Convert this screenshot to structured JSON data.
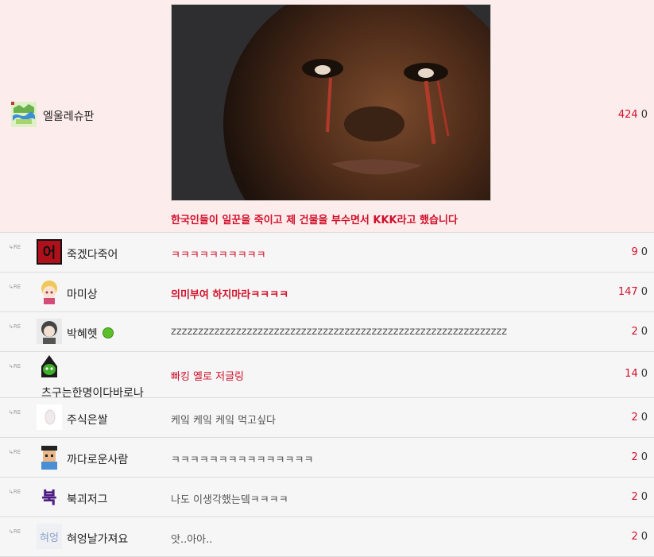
{
  "posts": [
    {
      "re": "",
      "nick": "엘울레슈판",
      "content": "한국인들이 일꾼을 죽이고 제 건물을 부수면서 KKK라고 했습니다",
      "hits": "424",
      "recs": "0"
    },
    {
      "re": "RE",
      "nick": "죽겠다죽어",
      "content": "ㅋㅋㅋㅋㅋㅋㅋㅋㅋㅋ",
      "hits": "9",
      "recs": "0"
    },
    {
      "re": "RE",
      "nick": "마미상",
      "content": "의미부여 하지마라ㅋㅋㅋㅋ",
      "hits": "147",
      "recs": "0"
    },
    {
      "re": "RE",
      "nick": "박혜헷",
      "content": "zzzzzzzzzzzzzzzzzzzzzzzzzzzzzzzzzzzzzzzzzzzzzzzzzzzzzzzzzzzzzz",
      "hits": "2",
      "recs": "0"
    },
    {
      "re": "RE",
      "nick": "츠구는한명이다바로나",
      "content": "빠킹 옐로 저글링",
      "hits": "14",
      "recs": "0"
    },
    {
      "re": "RE",
      "nick": "주식은쌀",
      "content": "케잌 케잌 케잌 먹고싶다",
      "hits": "2",
      "recs": "0"
    },
    {
      "re": "RE",
      "nick": "까다로운사람",
      "content": "ㅋㅋㅋㅋㅋㅋㅋㅋㅋㅋㅋㅋㅋㅋㅋ",
      "hits": "2",
      "recs": "0"
    },
    {
      "re": "RE",
      "nick": "북괴저그",
      "content": "나도 이생각했는뎈ㅋㅋㅋㅋ",
      "hits": "2",
      "recs": "0"
    },
    {
      "re": "RE",
      "nick": "혀엉날가져요",
      "content": "앗..아아..",
      "hits": "2",
      "recs": "0"
    }
  ]
}
